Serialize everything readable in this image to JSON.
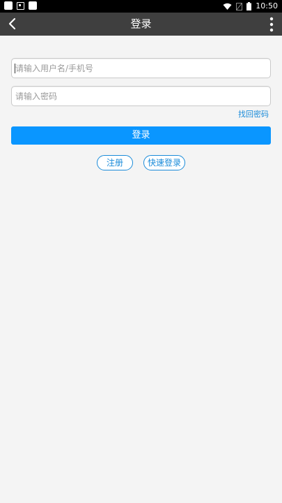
{
  "status_bar": {
    "time": "10:50"
  },
  "titlebar": {
    "title": "登录"
  },
  "form": {
    "username_placeholder": "请输入用户名/手机号",
    "password_placeholder": "请输入密码",
    "forgot_label": "找回密码",
    "login_label": "登录",
    "register_label": "注册",
    "quick_login_label": "快速登录"
  },
  "colors": {
    "accent": "#0a96ff",
    "link": "#1a8bd9",
    "titlebar": "#3f3f3f",
    "background": "#f4f4f4"
  },
  "icons": {
    "back": "back-arrow-icon",
    "more": "more-vertical-icon"
  }
}
